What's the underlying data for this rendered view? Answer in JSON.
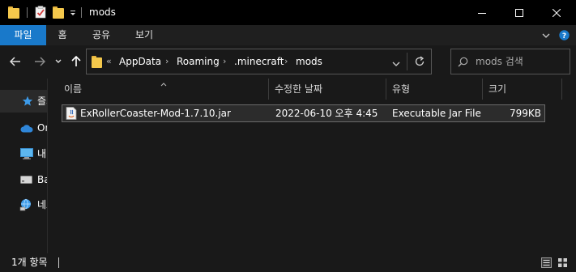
{
  "titlebar": {
    "title": "mods",
    "quick_access": [
      "folder-icon",
      "properties-icon",
      "new-folder-icon",
      "customize-chevron-icon"
    ],
    "window_buttons": [
      "minimize-icon",
      "maximize-icon",
      "close-icon"
    ]
  },
  "ribbon": {
    "tabs": [
      "파일",
      "홈",
      "공유",
      "보기"
    ],
    "active_tab": "파일",
    "accent_color": "#1979ca"
  },
  "address": {
    "overflow": "«",
    "crumbs": [
      "AppData",
      "Roaming",
      ".minecraft",
      "mods"
    ]
  },
  "search": {
    "placeholder": "mods 검색"
  },
  "nav": {
    "items": [
      {
        "label": "즐겨찾기",
        "icon": "star-icon"
      },
      {
        "label": "OneDrive",
        "icon": "cloud-icon"
      },
      {
        "label": "내 PC",
        "icon": "pc-icon"
      },
      {
        "label": "Backup",
        "icon": "drive-icon"
      },
      {
        "label": "네트워크",
        "icon": "network-icon"
      }
    ]
  },
  "columns": [
    "이름",
    "수정한 날짜",
    "유형",
    "크기"
  ],
  "files": [
    {
      "name": "ExRollerCoaster-Mod-1.7.10.jar",
      "modified": "2022-06-10 오후 4:45",
      "type": "Executable Jar File",
      "size": "799KB",
      "icon": "java-jar-icon"
    }
  ],
  "status": {
    "count": "1개 항목"
  }
}
